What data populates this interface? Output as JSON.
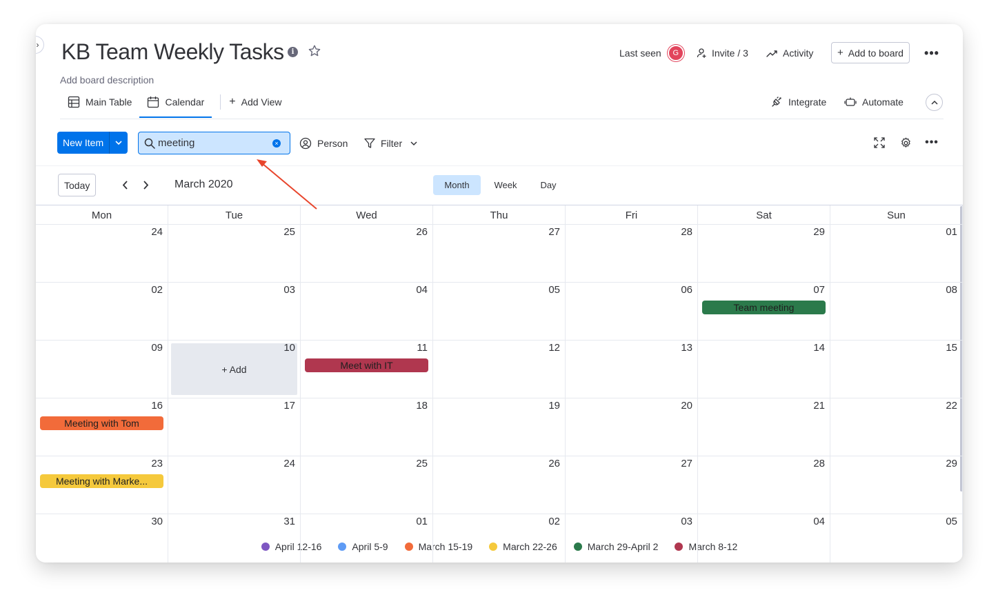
{
  "board": {
    "title": "KB Team Weekly Tasks",
    "description": "Add board description"
  },
  "header": {
    "last_seen": "Last seen",
    "avatar_initial": "G",
    "invite": "Invite / 3",
    "activity": "Activity",
    "add_to_board": "Add to board"
  },
  "views": {
    "main_table": "Main Table",
    "calendar": "Calendar",
    "add_view": "Add View",
    "integrate": "Integrate",
    "automate": "Automate"
  },
  "toolbar": {
    "new_item": "New Item",
    "search_value": "meeting",
    "person": "Person",
    "filter": "Filter"
  },
  "calendar": {
    "today": "Today",
    "month_label": "March 2020",
    "modes": [
      "Month",
      "Week",
      "Day"
    ],
    "active_mode": "Month",
    "weekdays": [
      "Mon",
      "Tue",
      "Wed",
      "Thu",
      "Fri",
      "Sat",
      "Sun"
    ],
    "weeks": [
      [
        "24",
        "25",
        "26",
        "27",
        "28",
        "29",
        "01"
      ],
      [
        "02",
        "03",
        "04",
        "05",
        "06",
        "07",
        "08"
      ],
      [
        "09",
        "10",
        "11",
        "12",
        "13",
        "14",
        "15"
      ],
      [
        "16",
        "17",
        "18",
        "19",
        "20",
        "21",
        "22"
      ],
      [
        "23",
        "24",
        "25",
        "26",
        "27",
        "28",
        "29"
      ],
      [
        "30",
        "31",
        "01",
        "02",
        "03",
        "04",
        "05"
      ]
    ],
    "add_label": "+ Add",
    "events": [
      {
        "label": "Team meeting",
        "week": 1,
        "day": 5,
        "color": "#2b7a4b"
      },
      {
        "label": "Meet with IT",
        "week": 2,
        "day": 2,
        "color": "#b0374f"
      },
      {
        "label": "Meeting with Tom",
        "week": 3,
        "day": 0,
        "color": "#f26b3a"
      },
      {
        "label": "Meeting with Marke...",
        "week": 4,
        "day": 0,
        "color": "#f5c93c"
      }
    ]
  },
  "legend": [
    {
      "label": "April 12-16",
      "color": "#7e57c2"
    },
    {
      "label": "April 5-9",
      "color": "#5e9bf5"
    },
    {
      "label": "March 15-19",
      "color": "#f26b3a"
    },
    {
      "label": "March 22-26",
      "color": "#f5c93c"
    },
    {
      "label": "March 29-April 2",
      "color": "#2b7a4b"
    },
    {
      "label": "March 8-12",
      "color": "#b0374f"
    }
  ],
  "colors": {
    "accent": "#0073ea",
    "search_bg": "#cce5ff",
    "annotation_arrow": "#e8452c"
  },
  "icons": [
    "info-icon",
    "star-icon",
    "person-add-icon",
    "activity-icon",
    "more-icon",
    "table-icon",
    "calendar-icon",
    "integrate-icon",
    "automate-icon",
    "chevron-up-icon",
    "search-icon",
    "clear-icon",
    "person-icon",
    "filter-icon",
    "expand-icon",
    "gear-icon",
    "chevron-left-icon",
    "chevron-right-icon"
  ]
}
